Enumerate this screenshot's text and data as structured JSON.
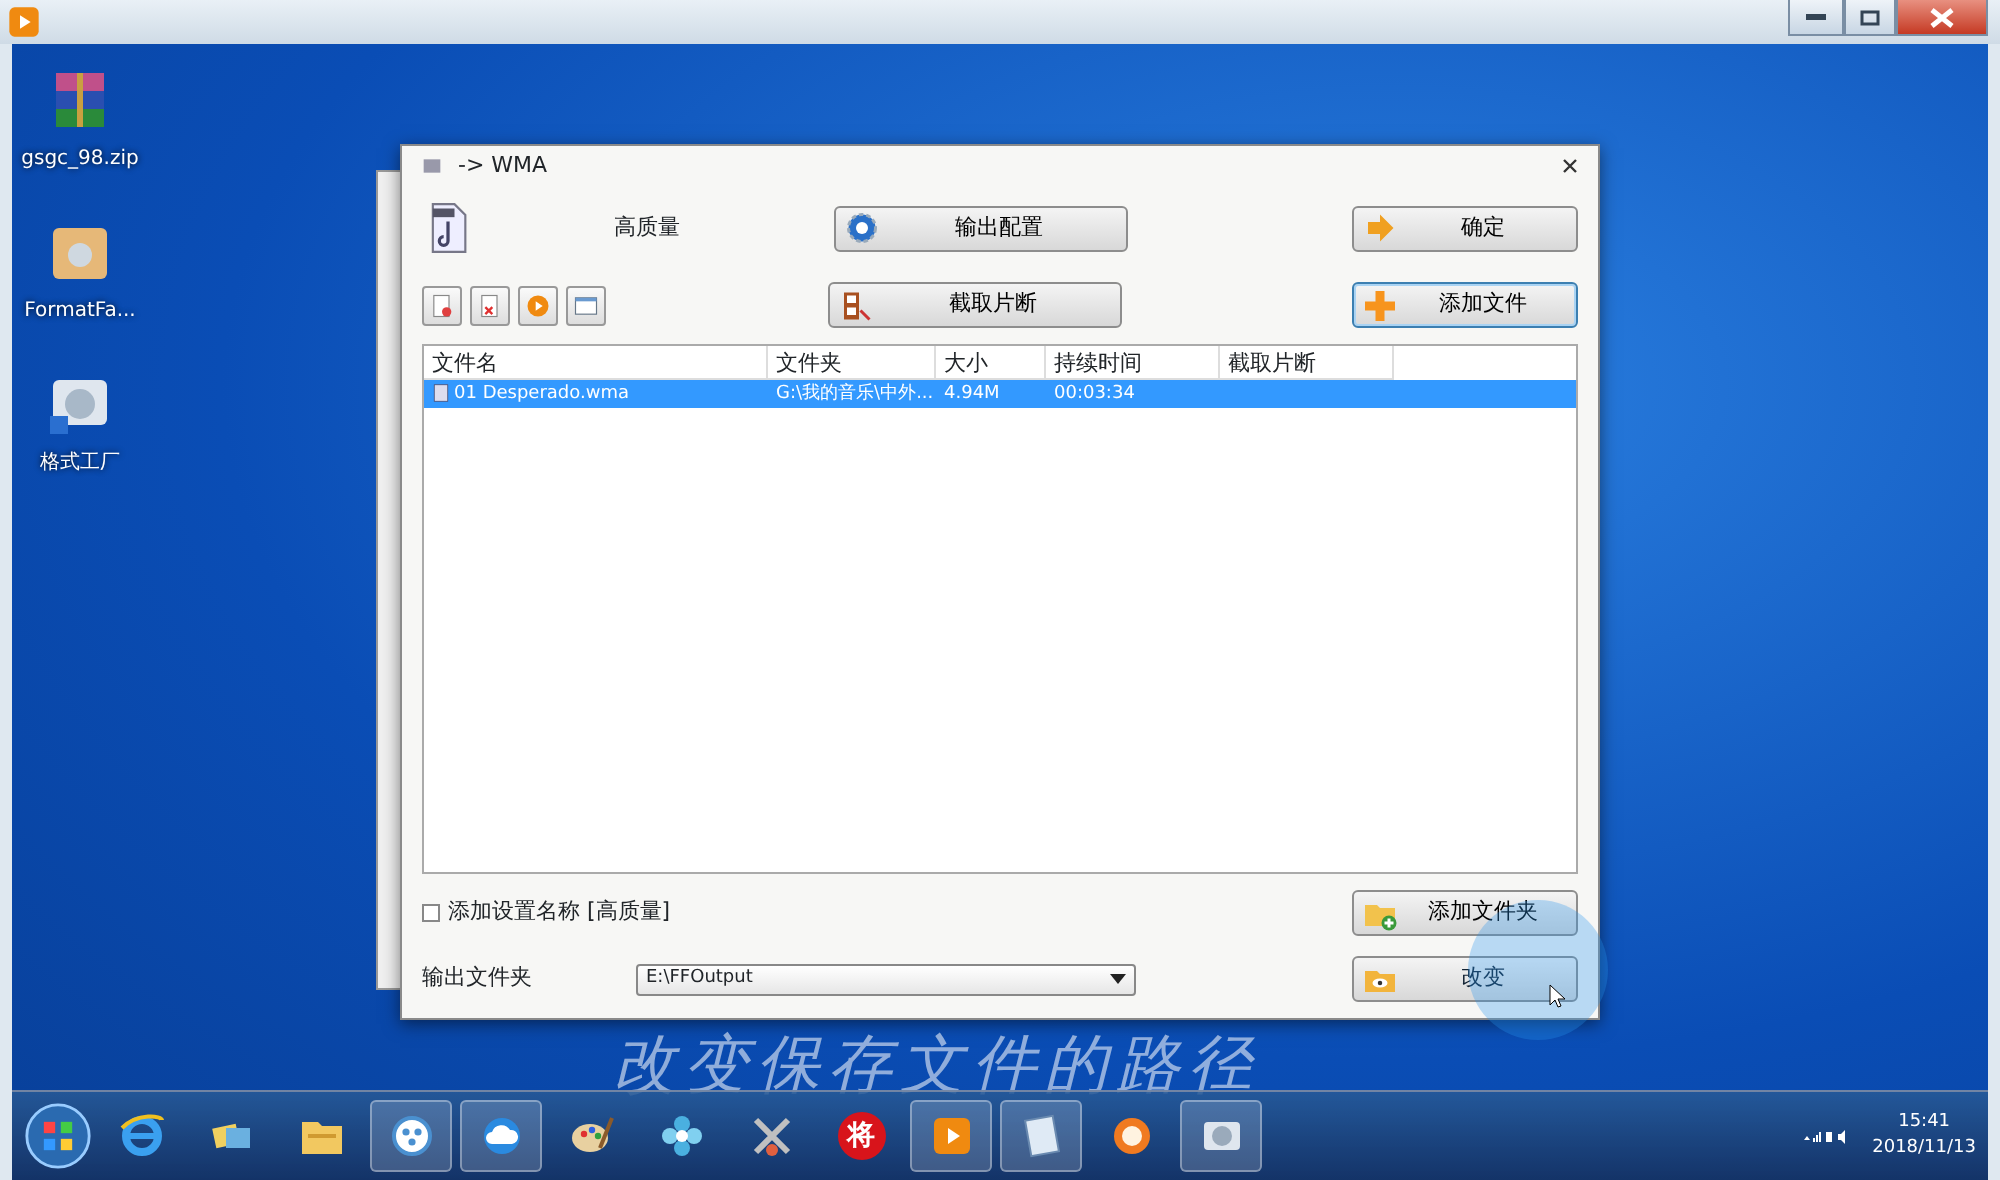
{
  "desktop_icons": [
    {
      "label": "gsgc_98.zip",
      "kind": "archive"
    },
    {
      "label": "FormatFa...",
      "kind": "package"
    },
    {
      "label": "格式工厂",
      "kind": "shortcut"
    }
  ],
  "dialog": {
    "title": "-> WMA",
    "quality": "高质量",
    "tools": [
      {
        "kind": "add"
      },
      {
        "kind": "delete"
      },
      {
        "kind": "play"
      },
      {
        "kind": "window"
      }
    ],
    "buttons": [
      {
        "label": "输出配置",
        "kind": "gear",
        "focused": false
      },
      {
        "label": "确定",
        "kind": "arrow",
        "focused": false
      },
      {
        "label": "截取片断",
        "kind": "film",
        "focused": false
      },
      {
        "label": "添加文件",
        "kind": "plus",
        "focused": true
      }
    ],
    "table": {
      "columns": [
        "文件名",
        "文件夹",
        "大小",
        "持续时间",
        "截取片断"
      ],
      "rows": [
        {
          "cells": [
            "01 Desperado.wma",
            "G:\\我的音乐\\中外...",
            "4.94M",
            "00:03:34"
          ],
          "selected": true
        }
      ]
    },
    "add_name": {
      "label": "添加设置名称 [高质量]",
      "checked": false
    },
    "add_folder_button": {
      "label": "添加文件夹",
      "kind": "folder-add",
      "focused": false
    },
    "output_folder": {
      "label": "输出文件夹",
      "value": "E:\\FFOutput"
    },
    "change_button": {
      "label": "改变",
      "kind": "folder-eye",
      "focused": false
    }
  },
  "caption": "改变保存文件的路径",
  "taskbar": {
    "items": [
      {
        "kind": "ie"
      },
      {
        "kind": "folders"
      },
      {
        "kind": "explorer"
      },
      {
        "kind": "dots"
      },
      {
        "kind": "cloud"
      },
      {
        "kind": "palette"
      },
      {
        "kind": "flower"
      },
      {
        "kind": "tools"
      },
      {
        "kind": "badge",
        "label": "将"
      },
      {
        "kind": "player"
      },
      {
        "kind": "notepad"
      },
      {
        "kind": "fox"
      },
      {
        "kind": "factory"
      }
    ],
    "time": "15:41",
    "date": "2018/11/13"
  }
}
